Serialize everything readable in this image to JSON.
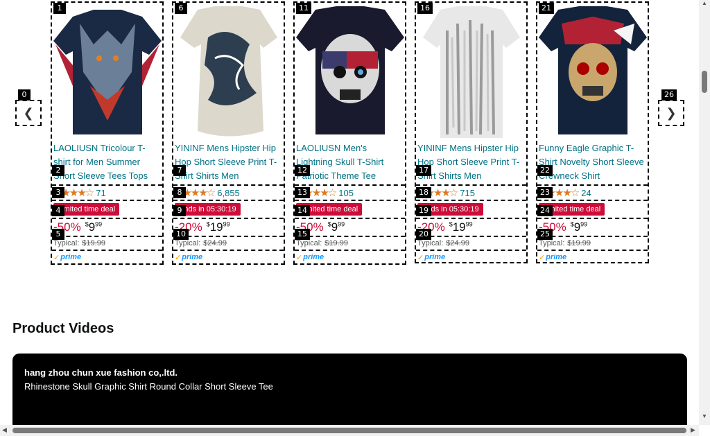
{
  "carousel": {
    "prev_tag": "0",
    "next_tag": "26",
    "cards": [
      {
        "image_tag": "1",
        "title": "LAOLIUSN Tricolour T-shirt for Men Summer Short Sleeve Tees Tops Mexico Theme Shirt...",
        "rating_tag": "2",
        "stars": "★★★★☆",
        "rating_count": "71",
        "deal_tag": "3",
        "deal": "Limited time deal",
        "price_tag": "4",
        "discount": "-50%",
        "currency": "$",
        "price_whole": "9",
        "price_fraction": "99",
        "typical_tag": "5",
        "typical_label": "Typical:",
        "typical_price": "$19.99",
        "prime": "prime"
      },
      {
        "image_tag": "6",
        "title": "YININF Mens Hipster Hip Hop Short Sleeve Print T-Shirt Shirts Men",
        "rating_tag": "7",
        "stars": "★★★★☆",
        "rating_count": "6,855",
        "deal_tag": "8",
        "deal": "Ends in 05:30:19",
        "price_tag": "9",
        "discount": "-20%",
        "currency": "$",
        "price_whole": "19",
        "price_fraction": "99",
        "typical_tag": "10",
        "typical_label": "Typical:",
        "typical_price": "$24.99",
        "prime": "prime"
      },
      {
        "image_tag": "11",
        "title": "LAOLIUSN Men's Lightning Skull T-Shirt Patriotic Theme Tee American Flag Graphic...",
        "rating_tag": "12",
        "stars": "★★★★☆",
        "rating_count": "105",
        "deal_tag": "13",
        "deal": "Limited time deal",
        "price_tag": "14",
        "discount": "-50%",
        "currency": "$",
        "price_whole": "9",
        "price_fraction": "99",
        "typical_tag": "15",
        "typical_label": "Typical:",
        "typical_price": "$19.99",
        "prime": "prime"
      },
      {
        "image_tag": "16",
        "title": "YININF Mens Hipster Hip Hop Short Sleeve Print T-Shirt Shirts Men",
        "rating_tag": "17",
        "stars": "★★★★☆",
        "rating_count": "715",
        "deal_tag": "18",
        "deal": "Ends in 05:30:19",
        "price_tag": "19",
        "discount": "-20%",
        "currency": "$",
        "price_whole": "19",
        "price_fraction": "99",
        "typical_tag": "20",
        "typical_label": "Typical:",
        "typical_price": "$24.99",
        "prime": "prime"
      },
      {
        "image_tag": "21",
        "title": "Funny Eagle Graphic T-Shirt Novelty Short Sleeve Crewneck Shirt",
        "rating_tag": "22",
        "stars": "★★★★☆",
        "rating_count": "24",
        "deal_tag": "23",
        "deal": "Limited time deal",
        "price_tag": "24",
        "discount": "-50%",
        "currency": "$",
        "price_whole": "9",
        "price_fraction": "99",
        "typical_tag": "25",
        "typical_label": "Typical:",
        "typical_price": "$19.99",
        "prime": "prime"
      }
    ]
  },
  "videos": {
    "heading": "Product Videos",
    "brand": "hang zhou chun xue fashion co,.ltd.",
    "title": "Rhinestone Skull Graphic Shirt Round Collar Short Sleeve Tee"
  },
  "colors": {
    "link": "#007185",
    "deal": "#cc0c39",
    "star": "#de7921",
    "prime": "#1a98ff"
  }
}
